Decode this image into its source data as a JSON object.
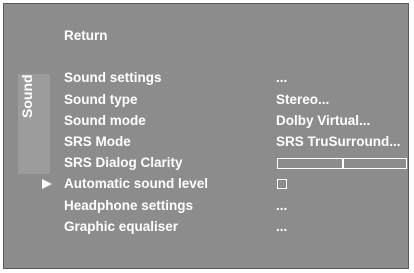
{
  "side_tab": {
    "label": "Sound"
  },
  "menu": {
    "return_label": "Return",
    "items": [
      {
        "label": "Sound settings",
        "value": "..."
      },
      {
        "label": "Sound type",
        "value": "Stereo..."
      },
      {
        "label": "Sound mode",
        "value": "Dolby Virtual..."
      },
      {
        "label": "SRS Mode",
        "value": "SRS TruSurround..."
      },
      {
        "label": "SRS Dialog Clarity",
        "value_level": 0.5
      },
      {
        "label": "Automatic sound level",
        "checked": false,
        "selected": true
      },
      {
        "label": "Headphone settings",
        "value": "..."
      },
      {
        "label": "Graphic equaliser",
        "value": "..."
      }
    ]
  },
  "colors": {
    "background": "#8c8c8c",
    "tab": "#9c9c9c",
    "text": "#ffffff"
  }
}
